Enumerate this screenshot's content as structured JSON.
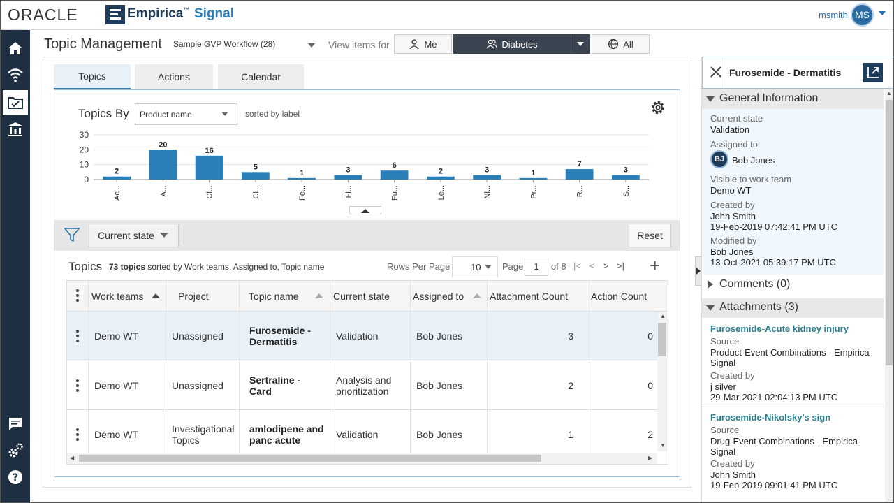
{
  "brand": {
    "oracle": "ORACLE",
    "empirica": "Empirica",
    "tm": "™",
    "signal": "Signal"
  },
  "user": {
    "name": "msmith",
    "initials": "MS"
  },
  "page": {
    "title": "Topic Management",
    "workflow": "Sample GVP Workflow (28)",
    "view_label": "View items for",
    "view_buttons": {
      "me": "Me",
      "diabetes": "Diabetes",
      "all": "All"
    }
  },
  "tabs": {
    "topics": "Topics",
    "actions": "Actions",
    "calendar": "Calendar"
  },
  "chart_header": {
    "title": "Topics By",
    "select_value": "Product name",
    "sorted_note": "sorted by label"
  },
  "chart_data": {
    "type": "bar",
    "categories": [
      "Ac...",
      "A...",
      "Cl...",
      "Ci...",
      "Fe...",
      "Fl...",
      "Fu...",
      "Le...",
      "Ni...",
      "Pr...",
      "R...",
      "S..."
    ],
    "values": [
      2,
      20,
      16,
      5,
      1,
      3,
      6,
      2,
      3,
      1,
      7,
      3
    ],
    "yticks": [
      0,
      10,
      20,
      30
    ],
    "ylim": [
      0,
      30
    ],
    "color": "#2a7fb8",
    "grid": true
  },
  "filter": {
    "state_button": "Current state",
    "reset": "Reset"
  },
  "topics": {
    "title": "Topics",
    "count_bold": "73 topics",
    "count_rest": " sorted by Work teams, Assigned to, Topic name",
    "rows_per_page_label": "Rows Per Page",
    "rows_per_page": "10",
    "page_label": "Page",
    "page": "1",
    "page_of": "of 8",
    "add": "+"
  },
  "table": {
    "columns": [
      "Work teams",
      "Project",
      "Topic name",
      "Current state",
      "Assigned to",
      "Attachment Count",
      "Action Count"
    ],
    "rows": [
      {
        "work_team": "Demo WT",
        "project": "Unassigned",
        "topic": "Furosemide - Dermatitis",
        "state": "Validation",
        "assigned": "Bob Jones",
        "attachments": "3",
        "actions": "0"
      },
      {
        "work_team": "Demo WT",
        "project": "Unassigned",
        "topic": "Sertraline - Card",
        "state": "Analysis and prioritization",
        "assigned": "Bob Jones",
        "attachments": "2",
        "actions": "0"
      },
      {
        "work_team": "Demo WT",
        "project": "Investigational Topics",
        "topic": "amlodipene and panc acute",
        "state": "Validation",
        "assigned": "Bob Jones",
        "attachments": "1",
        "actions": "2"
      }
    ]
  },
  "detail": {
    "title": "Furosemide - Dermatitis",
    "general_info": "General Information",
    "current_state_label": "Current state",
    "current_state": "Validation",
    "assigned_label": "Assigned to",
    "assigned_initials": "BJ",
    "assigned": "Bob Jones",
    "visible_label": "Visible to work team",
    "visible": "Demo WT",
    "created_label": "Created by",
    "created_by": "John Smith",
    "created_at": "19-Feb-2019 07:42:41 PM UTC",
    "modified_label": "Modified by",
    "modified_by": "Bob Jones",
    "modified_at": "13-Oct-2021 05:39:17 PM UTC",
    "comments": "Comments (0)",
    "attachments": "Attachments (3)",
    "att": [
      {
        "title": "Furosemide-Acute kidney injury",
        "source_label": "Source",
        "source_1": "Product-Event Combinations - Empirica",
        "source_2": "Signal",
        "created_label": "Created by",
        "created_by": "j silver",
        "created_at": "29-Mar-2021 02:04:13 PM UTC"
      },
      {
        "title": "Furosemide-Nikolsky's sign",
        "source_label": "Source",
        "source_1": "Drug-Event Combinations - Empirica",
        "source_2": "Signal",
        "created_label": "Created by",
        "created_by": "John Smith",
        "created_at": "19-Feb-2019 09:01:41 PM UTC"
      }
    ]
  }
}
